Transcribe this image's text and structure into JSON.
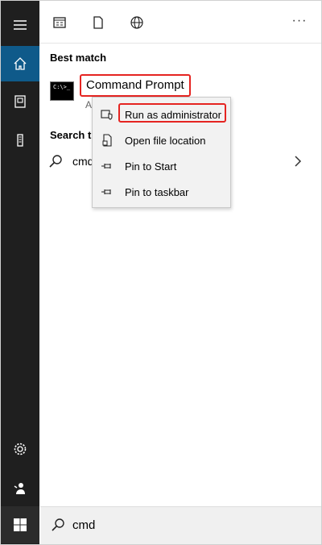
{
  "toolbar": {
    "more_label": "···"
  },
  "best_match": {
    "heading": "Best match",
    "title": "Command Prompt",
    "subtitle": "A",
    "icon_text": "C:\\>_"
  },
  "search_web": {
    "heading": "Search th",
    "query": "cmd"
  },
  "context_menu": {
    "items": [
      {
        "label": "Run as administrator",
        "icon": "shield-icon"
      },
      {
        "label": "Open file location",
        "icon": "file-location-icon"
      },
      {
        "label": "Pin to Start",
        "icon": "pin-icon"
      },
      {
        "label": "Pin to taskbar",
        "icon": "pin-icon"
      }
    ]
  },
  "search_box": {
    "value": "cmd"
  },
  "colors": {
    "rail": "#1f1f1f",
    "active": "#0f5a8a",
    "highlight": "#e52421"
  }
}
